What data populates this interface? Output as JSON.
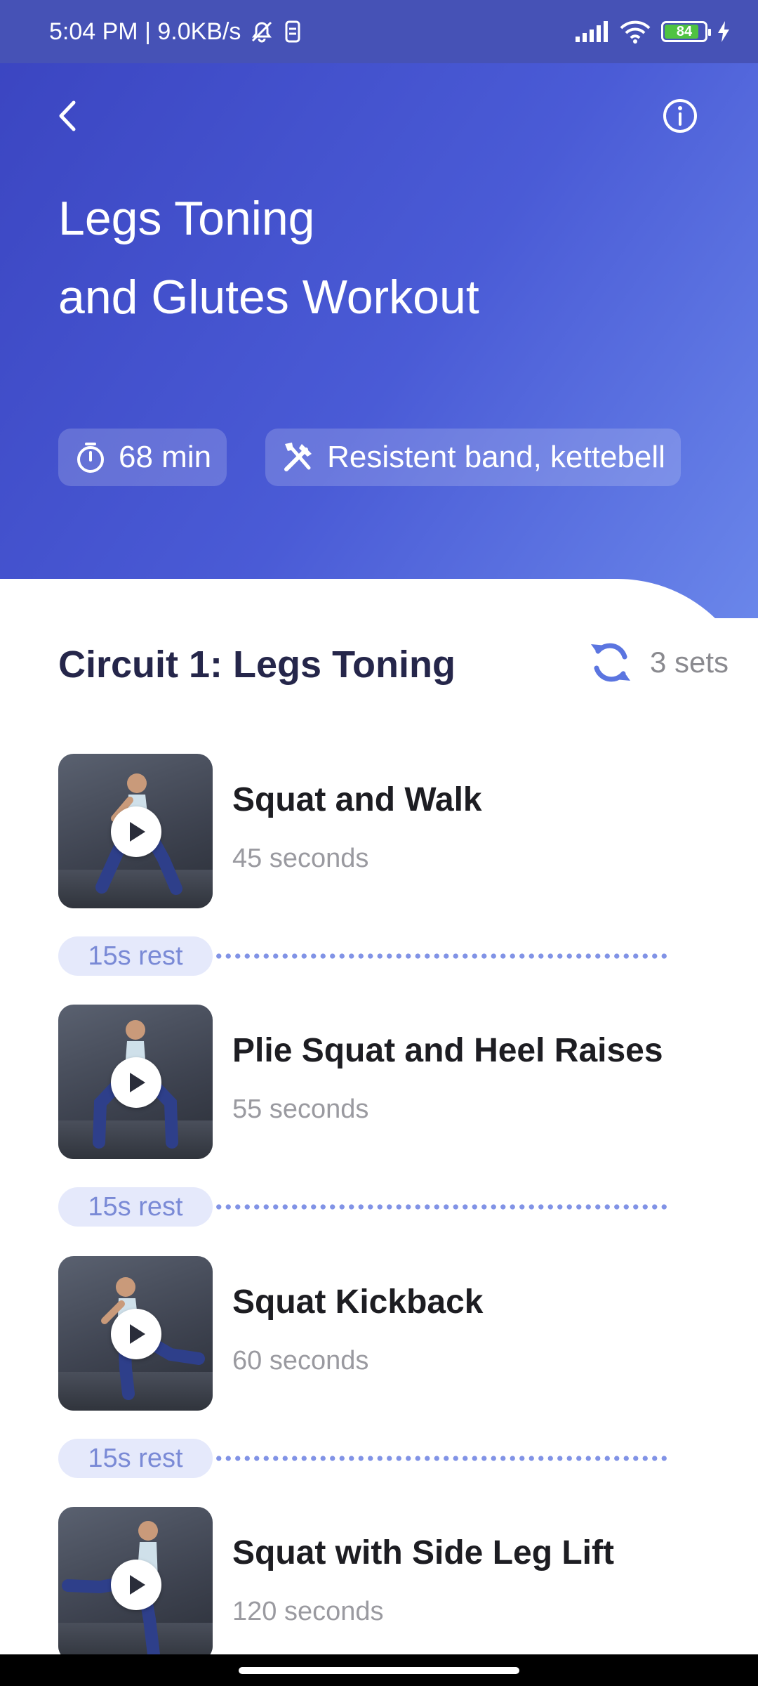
{
  "status_bar": {
    "time_speed": "5:04 PM | 9.0KB/s",
    "battery": "84",
    "colors": {
      "battery_fill": "#4fc341"
    }
  },
  "header": {
    "title_line1": "Legs Toning",
    "title_line2": "and Glutes Workout",
    "back_icon": "chevron-left-icon",
    "info_icon": "info-circle-icon",
    "chips": [
      {
        "icon": "stopwatch-icon",
        "label": "68 min"
      },
      {
        "icon": "tools-icon",
        "label": "Resistent band, kettebell"
      }
    ]
  },
  "circuit": {
    "title": "Circuit 1: Legs Toning",
    "sets_label": "3 sets",
    "sets_icon": "repeat-icon",
    "exercises": [
      {
        "name": "Squat and Walk",
        "duration": "45 seconds"
      },
      {
        "name": "Plie Squat and Heel Raises",
        "duration": "55 seconds"
      },
      {
        "name": "Squat Kickback",
        "duration": "60 seconds"
      },
      {
        "name": "Squat with Side Leg Lift",
        "duration": "120 seconds"
      }
    ],
    "rests": [
      {
        "label": "15s rest"
      },
      {
        "label": "15s rest"
      },
      {
        "label": "15s rest"
      }
    ]
  },
  "colors": {
    "header_gradient_start": "#3a44c0",
    "header_gradient_end": "#6a86ea",
    "accent": "#5b75e0",
    "rest_pill_bg": "#e5e9fb",
    "rest_text": "#7a8ad6"
  }
}
